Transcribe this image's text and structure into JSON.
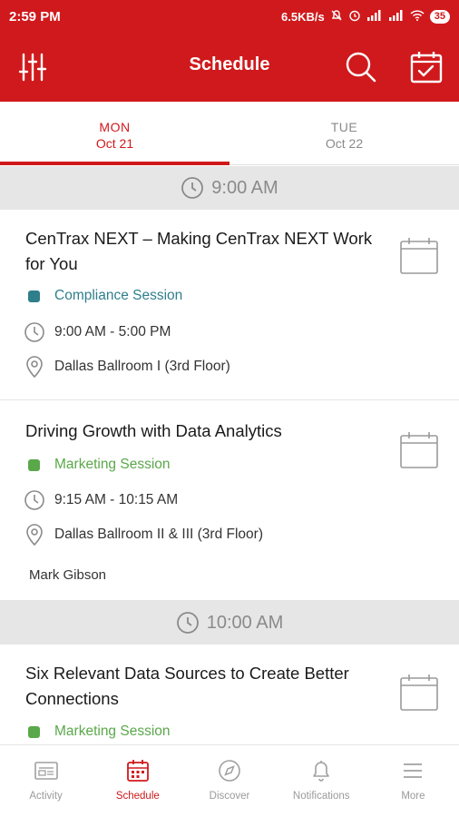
{
  "status_bar": {
    "time": "2:59 PM",
    "network_speed": "6.5KB/s",
    "battery": "35"
  },
  "app_bar": {
    "title": "Schedule"
  },
  "tabs": [
    {
      "dow": "MON",
      "date": "Oct 21",
      "active": true
    },
    {
      "dow": "TUE",
      "date": "Oct 22",
      "active": false
    }
  ],
  "time_slots": [
    {
      "label": "9:00 AM"
    },
    {
      "label": "10:00 AM"
    }
  ],
  "sessions": [
    {
      "title": "CenTrax NEXT – Making CenTrax NEXT Work for You",
      "track": "Compliance Session",
      "track_color": "#2f7e8c",
      "time": "9:00 AM - 5:00 PM",
      "location": "Dallas Ballroom I (3rd Floor)"
    },
    {
      "title": "Driving Growth with Data Analytics",
      "track": "Marketing Session",
      "track_color": "#5aa84a",
      "time": "9:15 AM - 10:15 AM",
      "location": "Dallas Ballroom II & III (3rd Floor)",
      "speaker": "Mark Gibson"
    },
    {
      "title": "Six Relevant Data Sources to Create Better Connections",
      "track": "Marketing Session",
      "track_color": "#5aa84a"
    }
  ],
  "bottom_nav": [
    {
      "label": "Activity",
      "icon": "activity-icon",
      "active": false
    },
    {
      "label": "Schedule",
      "icon": "schedule-icon",
      "active": true
    },
    {
      "label": "Discover",
      "icon": "compass-icon",
      "active": false
    },
    {
      "label": "Notifications",
      "icon": "bell-icon",
      "active": false
    },
    {
      "label": "More",
      "icon": "menu-icon",
      "active": false
    }
  ],
  "colors": {
    "brand": "#d0191c",
    "compliance": "#2f7e8c",
    "marketing": "#5aa84a"
  }
}
